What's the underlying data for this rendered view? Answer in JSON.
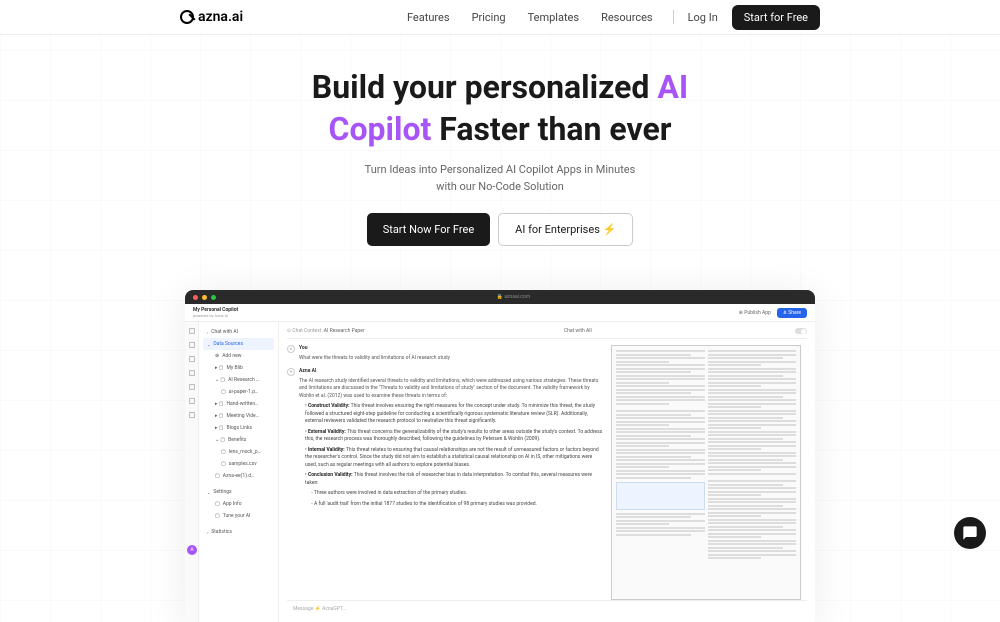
{
  "header": {
    "logo": "azna.ai",
    "nav": [
      "Features",
      "Pricing",
      "Templates",
      "Resources"
    ],
    "login": "Log In",
    "cta": "Start for Free"
  },
  "hero": {
    "line1_a": "Build your personalized ",
    "line1_b": "AI",
    "line2_a": "Copilot",
    "line2_b": " Faster than ever",
    "subtitle1": "Turn Ideas into Personalized AI Copilot Apps in Minutes",
    "subtitle2": "with our No-Code Solution",
    "primary": "Start Now For Free",
    "secondary": "AI for Enterprises ⚡"
  },
  "app": {
    "url": "🔒 aznaai.com",
    "title": "My Personal Copilot",
    "subtitle": "powered by Azna AI",
    "publish": "⊕ Publish App",
    "share": "⋔ Share",
    "sidebar": {
      "chat": "Chat with AI",
      "data_sources": "Data Sources",
      "add_new": "Add new",
      "items": [
        "My Blib",
        "AI Research …",
        "  ai-paper-1.p…",
        "Hand-written…",
        "Meeting Vide…",
        "Blogs Links",
        "Benefits",
        "  lens_mock_p…",
        "  samples.csv",
        "Azna-ee(1).d…"
      ],
      "settings": "Settings",
      "app_info": "App Info",
      "tune": "Tune your AI",
      "statistics": "Statistics"
    },
    "context_label": "⊙ Chat Context :",
    "context_value": " AI Research Paper",
    "chat_toggle": "Chat with All",
    "user_name": "You",
    "user_msg": "What were the threats to validity and limitations of AI research study",
    "ai_name": "Azna AI",
    "ai_intro": "The AI research study identified several threats to validity and limitations, which were addressed using various strategies. These threats and limitations are discussed in the \"Threats to validity and limitations of study\" section of the document. The validity framework by Wohlin et al. (2012) was used to examine these threats in terms of:",
    "bullets": [
      {
        "t": "Construct Validity:",
        "d": "This threat involves ensuring the right measures for the concept under study. To minimize this threat, the study followed a structured eight-step guideline for conducting a scientifically rigorous systematic literature review (SLR). Additionally, external reviewers validated the research protocol to neutralize this threat significantly."
      },
      {
        "t": "External Validity:",
        "d": "This threat concerns the generalizability of the study's results to other areas outside the study's context. To address this, the research process was thoroughly described, following the guidelines by Petersen & Wohlin (2009)."
      },
      {
        "t": "Internal Validity:",
        "d": "This threat relates to ensuring that causal relationships are not the result of unmeasured factors or factors beyond the researcher's control. Since the study did not aim to establish a statistical causal relationship on AI in IS, other mitigations were used, such as regular meetings with all authors to explore potential biases."
      },
      {
        "t": "Conclusion Validity:",
        "d": "This threat involves the risk of researcher bias in data interpretation. To combat this, several measures were taken:"
      }
    ],
    "sub_bullets": [
      "Three authors were involved in data extraction of the primary studies.",
      "A full 'audit trail' from the initial 1877 studies to the identification of 98 primary studies was provided."
    ],
    "input_placeholder": "Message    ⚡ AznaGPT…"
  }
}
